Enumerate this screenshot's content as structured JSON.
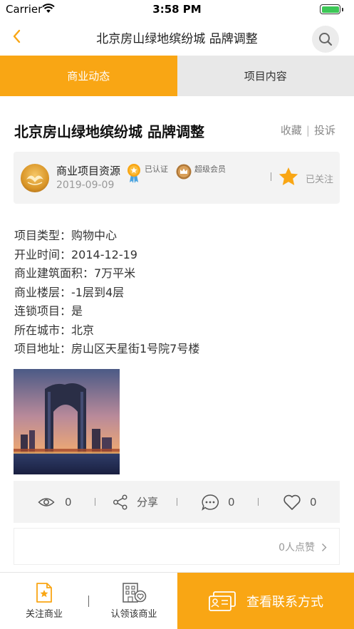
{
  "status_bar": {
    "carrier": "Carrier",
    "time": "3:58 PM"
  },
  "nav": {
    "title": "北京房山绿地缤纷城 品牌调整",
    "back_icon": "chevron-left-icon",
    "search_icon": "search-icon"
  },
  "tabs": [
    {
      "label": "商业动态",
      "active": true
    },
    {
      "label": "项目内容",
      "active": false
    }
  ],
  "article": {
    "title": "北京房山绿地缤纷城 品牌调整",
    "favorite_label": "收藏",
    "report_label": "投诉",
    "separator": "|"
  },
  "author": {
    "name": "商业项目资源",
    "verified_label": "已认证",
    "vip_label": "超级会员",
    "date": "2019-09-09",
    "separator": "|",
    "follow_label": "已关注"
  },
  "details": [
    "项目类型：购物中心",
    "开业时间：2014-12-19",
    "商业建筑面积：7万平米",
    "商业楼层：-1层到4层",
    "连锁项目：是",
    "所在城市：北京",
    "项目地址：房山区天星街1号院7号楼"
  ],
  "stats": {
    "views": "0",
    "share_label": "分享",
    "comments": "0",
    "likes": "0",
    "separator": "|"
  },
  "likes_row": {
    "text": "0人点赞"
  },
  "bottom_bar": {
    "follow_business_label": "关注商业",
    "claim_business_label": "认领该商业",
    "separator": "|",
    "contact_label": "查看联系方式"
  },
  "colors": {
    "accent": "#f9a614",
    "tab_inactive": "#e8e8e8",
    "card_bg": "#f3f3f3",
    "battery": "#3cc756"
  }
}
